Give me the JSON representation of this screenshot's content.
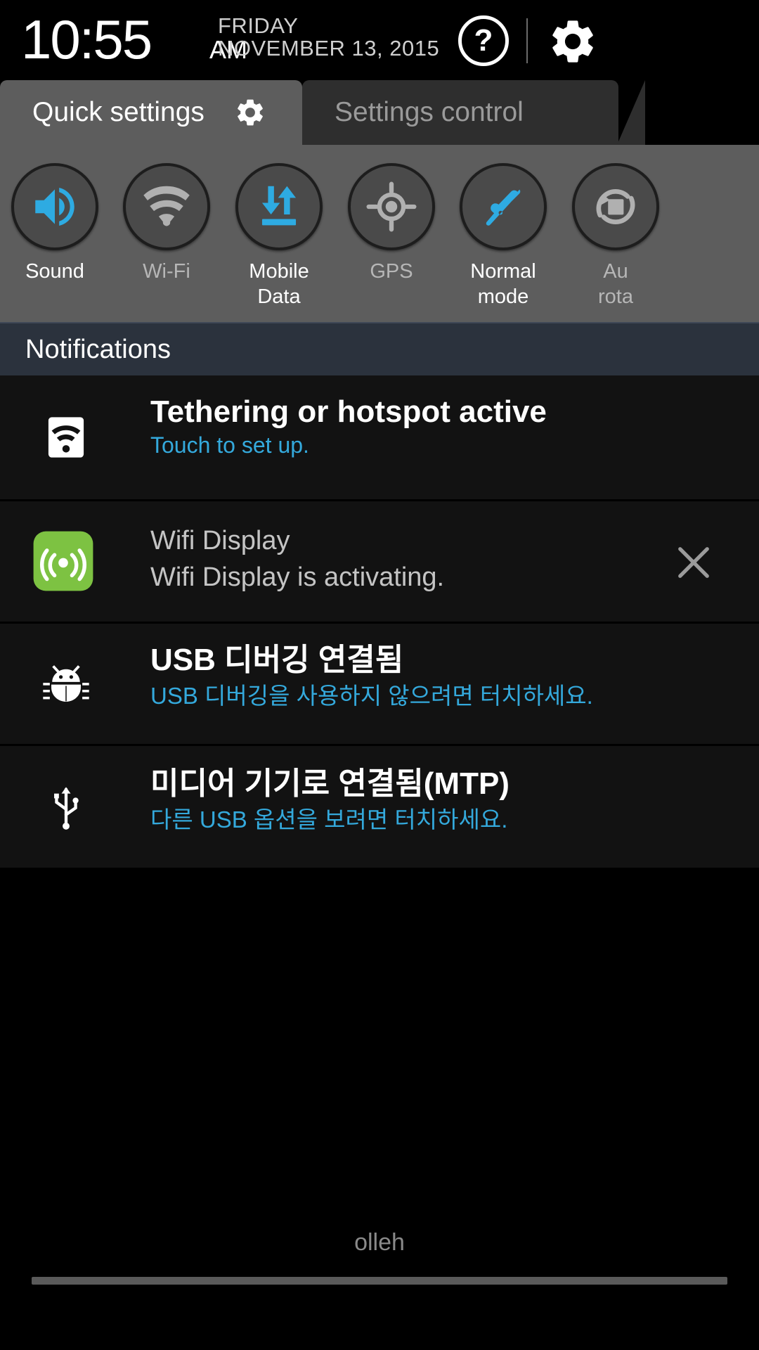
{
  "status_bar": {
    "time": "10:55",
    "am_pm": "AM",
    "day_of_week": "FRIDAY",
    "date": "NOVEMBER 13, 2015",
    "help_icon": "help-question-icon",
    "help_glyph": "?",
    "settings_icon": "gear-icon"
  },
  "tabs": [
    {
      "label": "Quick settings",
      "active": true,
      "icon": "gear-icon"
    },
    {
      "label": "Settings control",
      "active": false,
      "icon": null
    }
  ],
  "quick_settings": {
    "accent_on_color": "#2eabe2",
    "accent_off_color": "#b0b0b0",
    "panel_bg": "#5d5d5d",
    "toggles": [
      {
        "label": "Sound",
        "icon": "sound-speaker-icon",
        "state": "on"
      },
      {
        "label": "Wi-Fi",
        "icon": "wifi-icon",
        "state": "off"
      },
      {
        "label": "Mobile\nData",
        "label_line1": "Mobile",
        "label_line2": "Data",
        "icon": "mobile-data-icon",
        "state": "on"
      },
      {
        "label": "GPS",
        "icon": "gps-crosshair-icon",
        "state": "off"
      },
      {
        "label": "Normal\nmode",
        "label_line1": "Normal",
        "label_line2": "mode",
        "icon": "hand-pointer-icon",
        "state": "on"
      },
      {
        "label": "Auto\nrotate",
        "label_line1": "Au",
        "label_line2": "rota",
        "icon": "auto-rotate-icon",
        "state": "off"
      }
    ]
  },
  "notifications_section": {
    "header": "Notifications",
    "header_bg": "#2b323d",
    "items": [
      {
        "icon": "hotspot-icon",
        "title": "Tethering or hotspot active",
        "subtitle": "Touch to set up.",
        "subtitle_color": "cyan",
        "title_style": "bold",
        "dismissible": false
      },
      {
        "icon": "wifi-display-app-icon",
        "icon_bg": "#7dc242",
        "title": "Wifi Display",
        "subtitle": "Wifi Display is activating.",
        "subtitle_color": "gray",
        "title_style": "light",
        "dismissible": true,
        "dismiss_icon": "close-x-icon"
      },
      {
        "icon": "usb-debug-bug-icon",
        "title": "USB 디버깅 연결됨",
        "subtitle": "USB 디버깅을 사용하지 않으려면 터치하세요.",
        "subtitle_color": "cyan",
        "title_style": "bold",
        "dismissible": false
      },
      {
        "icon": "usb-trident-icon",
        "title": "미디어 기기로 연결됨(MTP)",
        "subtitle": "다른 USB 옵션을 보려면 터치하세요.",
        "subtitle_color": "cyan",
        "title_style": "bold",
        "dismissible": false
      }
    ]
  },
  "footer": {
    "carrier": "olleh",
    "drag_handle": "notification-shade-drag-handle"
  }
}
